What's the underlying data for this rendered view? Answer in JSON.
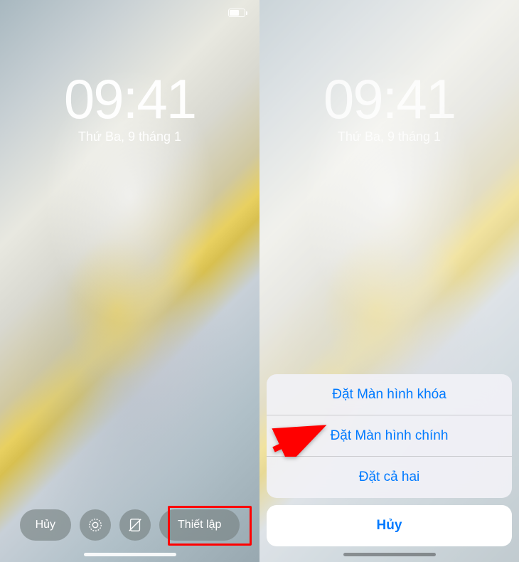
{
  "left_phone": {
    "time": "09:41",
    "date": "Thứ Ba, 9 tháng 1",
    "cancel_label": "Hủy",
    "setup_label": "Thiết lập"
  },
  "right_phone": {
    "time": "09:41",
    "date": "Thứ Ba, 9 tháng 1",
    "action_sheet": {
      "options": [
        "Đặt Màn hình khóa",
        "Đặt Màn hình chính",
        "Đặt cả hai"
      ],
      "cancel_label": "Hủy"
    }
  },
  "colors": {
    "ios_blue": "#007aff",
    "highlight_red": "#ff0000"
  }
}
